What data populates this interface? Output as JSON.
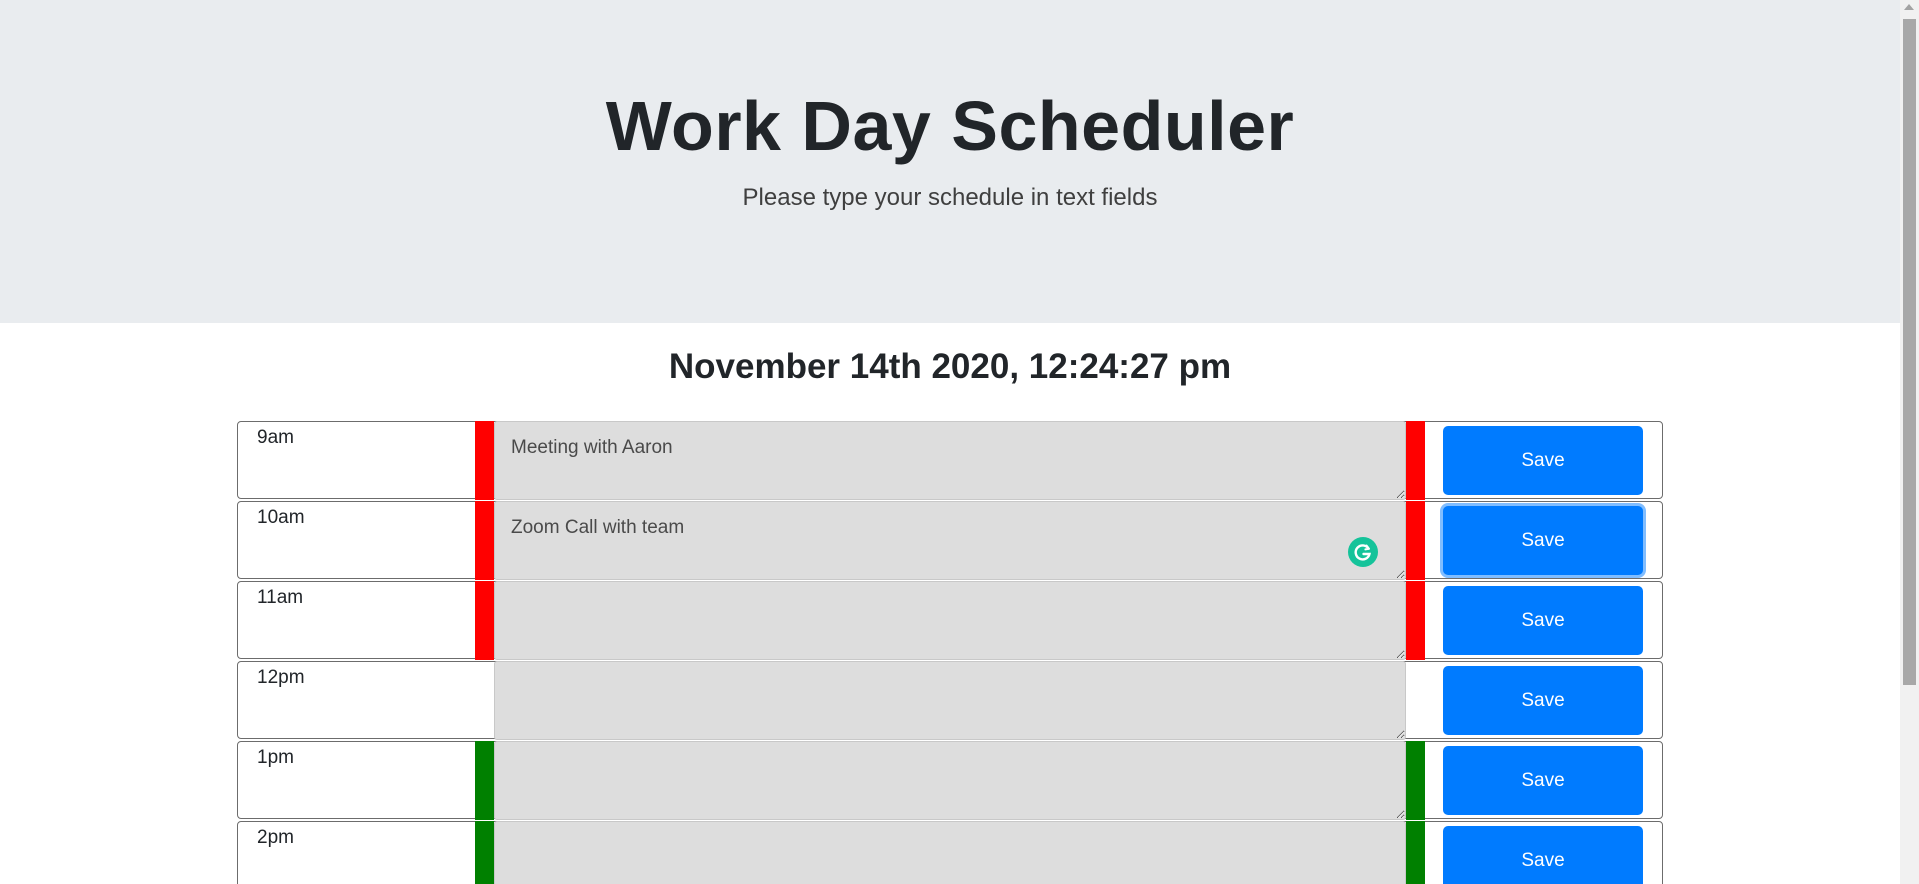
{
  "header": {
    "title": "Work Day Scheduler",
    "lead": "Please type your schedule in text fields"
  },
  "current_day": "November 14th 2020, 12:24:27 pm",
  "time_blocks": [
    {
      "hour": "9am",
      "text": "Meeting with Aaron",
      "status": "past",
      "save_label": "Save"
    },
    {
      "hour": "10am",
      "text": "Zoom Call with team",
      "status": "past",
      "save_label": "Save"
    },
    {
      "hour": "11am",
      "text": "",
      "status": "past",
      "save_label": "Save"
    },
    {
      "hour": "12pm",
      "text": "",
      "status": "present",
      "save_label": "Save"
    },
    {
      "hour": "1pm",
      "text": "",
      "status": "future",
      "save_label": "Save"
    },
    {
      "hour": "2pm",
      "text": "",
      "status": "future",
      "save_label": "Save"
    }
  ],
  "colors": {
    "past": "#ff0000",
    "present": "#ffffff",
    "future": "#008000",
    "save_button": "#007bff",
    "textarea_bg": "#dddddd",
    "grammarly_icon": "#15c39a"
  },
  "icons": {
    "grammarly": "grammarly-icon",
    "resize": "resize-grip-icon"
  }
}
